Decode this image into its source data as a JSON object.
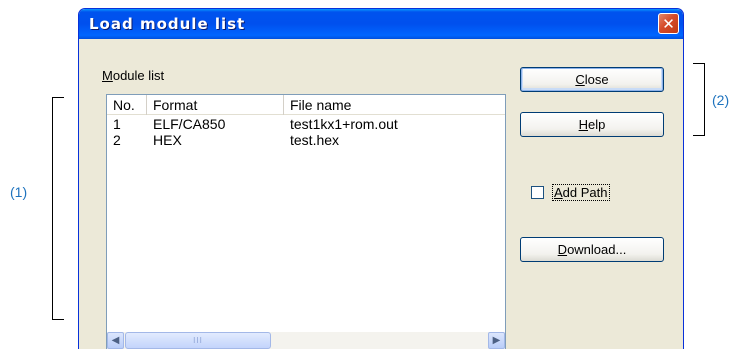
{
  "window": {
    "title": "Load module list",
    "close_glyph": "✕"
  },
  "module_list": {
    "label_accel": "M",
    "label_rest": "odule list",
    "columns": [
      "No.",
      "Format",
      "File name"
    ],
    "rows": [
      {
        "no": "1",
        "format": "ELF/CA850",
        "file": "test1kx1+rom.out"
      },
      {
        "no": "2",
        "format": "HEX",
        "file": "test.hex"
      }
    ],
    "scroll_left": "◀",
    "scroll_right": "▶",
    "thumb_grip": "III"
  },
  "buttons": {
    "close": {
      "accel": "C",
      "rest": "lose"
    },
    "help": {
      "accel": "H",
      "rest": "elp"
    },
    "download": {
      "accel": "D",
      "rest": "ownload..."
    }
  },
  "add_path": {
    "accel": "A",
    "rest": "dd Path",
    "checked": false
  },
  "annotations": {
    "left": "(1)",
    "right": "(2)"
  }
}
